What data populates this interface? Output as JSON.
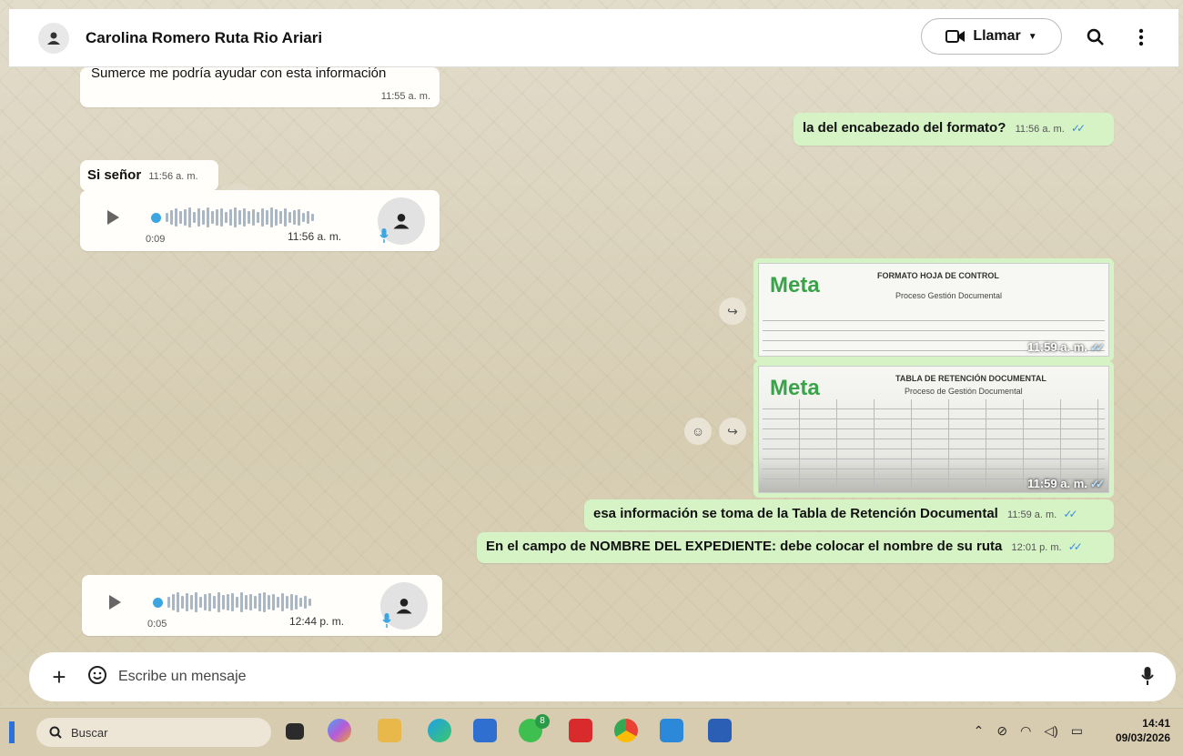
{
  "header": {
    "contact_name": "Carolina Romero Ruta Rio Ariari",
    "call_label": "Llamar"
  },
  "messages": {
    "m1": {
      "text": "Sumerce me podría ayudar con esta información",
      "time": "11:55 a. m."
    },
    "m2": {
      "text": "la del encabezado del formato?",
      "time": "11:56 a. m."
    },
    "m3": {
      "text": "Si señor",
      "time": "11:56 a. m."
    },
    "voice1": {
      "duration": "0:09",
      "time": "11:56 a. m."
    },
    "img1": {
      "logo": "Meta",
      "title": "FORMATO HOJA DE CONTROL",
      "subtitle": "Proceso Gestión Documental",
      "time": "11:59 a. m."
    },
    "img2": {
      "logo": "Meta",
      "title": "TABLA DE RETENCIÓN DOCUMENTAL",
      "subtitle": "Proceso de Gestión Documental",
      "time": "11:59 a. m."
    },
    "m4": {
      "text": "esa información se toma de la Tabla de Retención Documental",
      "time": "11:59 a. m."
    },
    "m5": {
      "text": "En el campo de NOMBRE DEL EXPEDIENTE: debe colocar el nombre de su ruta",
      "time": "12:01 p. m."
    },
    "voice2": {
      "duration": "0:05",
      "time": "12:44 p. m."
    }
  },
  "composer": {
    "placeholder": "Escribe un mensaje"
  },
  "taskbar": {
    "search_label": "Buscar",
    "whatsapp_badge": "8",
    "time": "14:41",
    "date": "09/03/2026"
  },
  "colors": {
    "outgoing_bubble": "#d6f3c6",
    "incoming_bubble": "#fffefa",
    "read_ticks": "#3b8de0",
    "brand_green": "#3aa34a"
  }
}
